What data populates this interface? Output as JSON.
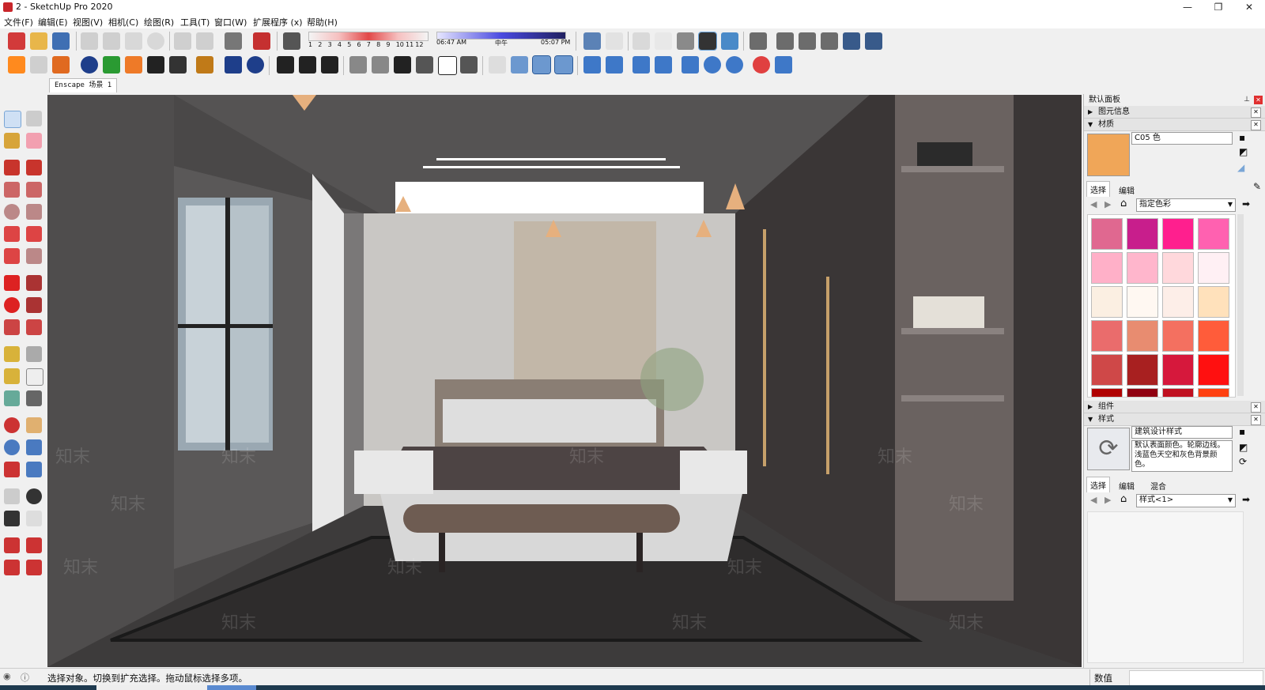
{
  "window": {
    "title": "2 - SketchUp Pro 2020",
    "controls": [
      "—",
      "❐",
      "✕"
    ]
  },
  "menu": [
    "文件(F)",
    "编辑(E)",
    "视图(V)",
    "相机(C)",
    "绘图(R)",
    "工具(T)",
    "窗口(W)",
    "扩展程序 (x)",
    "帮助(H)"
  ],
  "shadow": {
    "months": [
      "1",
      "2",
      "3",
      "4",
      "5",
      "6",
      "7",
      "8",
      "9",
      "10",
      "11",
      "12"
    ],
    "time_start": "06:47 AM",
    "time_mid": "中午",
    "time_end": "05:07 PM"
  },
  "scene_tab": "Enscape 场景 1",
  "panel": {
    "title": "默认面板",
    "entity_info": "图元信息",
    "materials": "材质",
    "material_name": "C05 色",
    "material_color": "#f0a658",
    "mat_tabs": [
      "选择",
      "编辑"
    ],
    "mat_collection": "指定色彩",
    "swatches": [
      "#e06890",
      "#c81e8c",
      "#ff1f8e",
      "#ff61b0",
      "#ffb0c8",
      "#ffb6cc",
      "#ffd8dc",
      "#fff0f4",
      "#fbefe2",
      "#fff8f2",
      "#fdeee8",
      "#ffe1bb",
      "#ea6c6c",
      "#e88c70",
      "#f47060",
      "#ff5c3a",
      "#cf4848",
      "#a82020",
      "#d6183c",
      "#ff1010",
      "#b00000",
      "#900010",
      "#c01020",
      "#ff4010"
    ],
    "components": "组件",
    "styles": "样式",
    "style_name": "建筑设计样式",
    "style_desc": "默认表面颜色。轮廓边线。浅蓝色天空和灰色背景颜色。",
    "style_tabs": [
      "选择",
      "编辑",
      "混合"
    ],
    "style_collection": "样式<1>"
  },
  "status": {
    "message": "选择对象。切换到扩充选择。拖动鼠标选择多项。",
    "measure_label": "数值"
  },
  "watermark": "知末"
}
